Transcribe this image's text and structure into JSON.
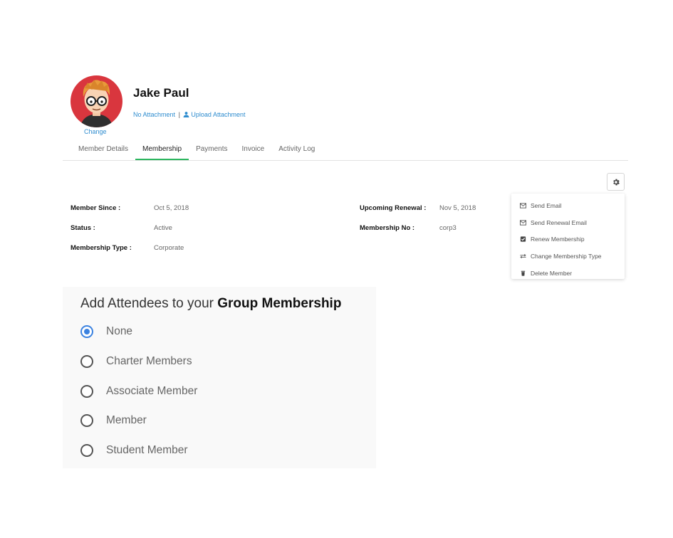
{
  "profile": {
    "name": "Jake Paul",
    "change_label": "Change",
    "attachment_status": "No Attachment",
    "separator": "|",
    "upload_label": "Upload Attachment"
  },
  "tabs": [
    {
      "label": "Member Details"
    },
    {
      "label": "Membership",
      "active": true
    },
    {
      "label": "Payments"
    },
    {
      "label": "Invoice"
    },
    {
      "label": "Activity Log"
    }
  ],
  "actions_menu": {
    "trigger_icon": "gear-icon",
    "items": [
      {
        "label": "Send Email",
        "icon": "envelope-icon"
      },
      {
        "label": "Send Renewal Email",
        "icon": "envelope-icon"
      },
      {
        "label": "Renew Membership",
        "icon": "checkbox-icon"
      },
      {
        "label": "Change Membership Type",
        "icon": "exchange-icon"
      },
      {
        "label": "Delete Member",
        "icon": "trash-icon"
      }
    ]
  },
  "details": {
    "member_since": {
      "label": "Member Since :",
      "value": "Oct 5, 2018"
    },
    "status": {
      "label": "Status :",
      "value": "Active"
    },
    "membership_type": {
      "label": "Membership Type :",
      "value": "Corporate"
    },
    "upcoming_renewal": {
      "label": "Upcoming Renewal :",
      "value": "Nov 5, 2018"
    },
    "membership_no": {
      "label": "Membership No :",
      "value": "corp3"
    }
  },
  "group_membership": {
    "title_prefix": "Add Attendees to your",
    "title_bold": "Group Membership",
    "options": [
      {
        "label": "None",
        "selected": true
      },
      {
        "label": "Charter Members",
        "selected": false
      },
      {
        "label": "Associate Member",
        "selected": false
      },
      {
        "label": "Member",
        "selected": false
      },
      {
        "label": "Student Member",
        "selected": false
      }
    ]
  },
  "colors": {
    "link": "#2e8ccf",
    "active_tab_underline": "#2ab55d",
    "avatar_bg": "#d9363e",
    "radio_selected": "#3b82e0"
  }
}
